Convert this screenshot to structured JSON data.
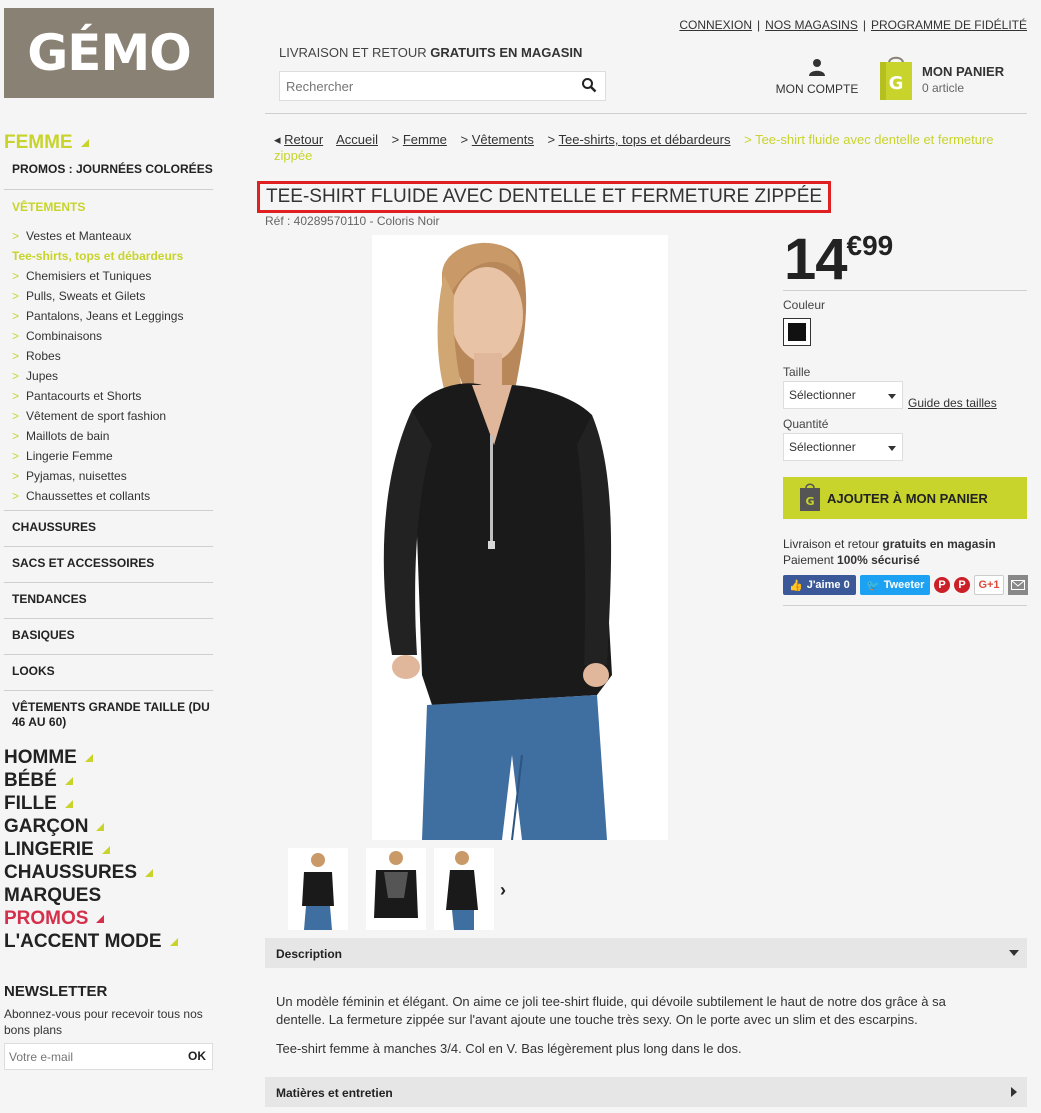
{
  "brand": {
    "logo_text": "GÉMO"
  },
  "header": {
    "top_links": [
      "CONNEXION",
      "NOS MAGASINS",
      "PROGRAMME DE FIDÉLITÉ"
    ],
    "shipping_prefix": "LIVRAISON ET RETOUR",
    "shipping_bold": "GRATUITS EN MAGASIN",
    "search_placeholder": "Rechercher",
    "account_label": "MON COMPTE",
    "cart_title": "MON PANIER",
    "cart_count": "0 article"
  },
  "sidebar": {
    "main_category": "FEMME",
    "promo_section": "PROMOS : JOURNÉES COLORÉES",
    "sub_header": "VÊTEMENTS",
    "sub_items": [
      "Vestes et Manteaux",
      "Tee-shirts, tops et débardeurs",
      "Chemisiers et Tuniques",
      "Pulls, Sweats et Gilets",
      "Pantalons, Jeans et Leggings",
      "Combinaisons",
      "Robes",
      "Jupes",
      "Pantacourts et Shorts",
      "Vêtement de sport fashion",
      "Maillots de bain",
      "Lingerie Femme",
      "Pyjamas, nuisettes",
      "Chaussettes et collants"
    ],
    "active_sub": "Tee-shirts, tops et débardeurs",
    "sections": [
      "CHAUSSURES",
      "SACS ET ACCESSOIRES",
      "TENDANCES",
      "BASIQUES",
      "LOOKS",
      "VÊTEMENTS GRANDE TAILLE (DU 46 AU 60)"
    ],
    "big_categories": [
      "HOMME",
      "BÉBÉ",
      "FILLE",
      "GARÇON",
      "LINGERIE",
      "CHAUSSURES",
      "MARQUES",
      "PROMOS",
      "L'ACCENT MODE"
    ],
    "newsletter_title": "NEWSLETTER",
    "newsletter_text": "Abonnez-vous pour recevoir tous nos bons plans",
    "newsletter_placeholder": "Votre e-mail",
    "newsletter_ok": "OK"
  },
  "breadcrumb": {
    "back": "Retour",
    "items": [
      "Accueil",
      "Femme",
      "Vêtements",
      "Tee-shirts, tops et débardeurs"
    ],
    "current": "Tee-shirt fluide avec dentelle et fermeture zippée"
  },
  "product": {
    "title": "TEE-SHIRT FLUIDE AVEC DENTELLE ET FERMETURE ZIPPÉE",
    "ref": "Réf : 40289570110 - Coloris Noir",
    "price_int": "14",
    "price_dec": "€99",
    "color_label": "Couleur",
    "size_label": "Taille",
    "size_value": "Sélectionner",
    "size_guide": "Guide des tailles",
    "qty_label": "Quantité",
    "qty_value": "Sélectionner",
    "add_to_cart": "AJOUTER À MON PANIER",
    "delivery_prefix": "Livraison et retour",
    "delivery_bold": "gratuits en magasin",
    "payment_prefix": "Paiement",
    "payment_bold": "100% sécurisé",
    "fb_label": "J'aime 0",
    "tw_label": "Tweeter",
    "pin_label": "P",
    "gplus_label": "G+1"
  },
  "accordions": {
    "description_title": "Description",
    "description_p1": "Un modèle féminin et élégant. On aime ce joli tee-shirt fluide, qui dévoile subtilement le haut de notre dos grâce à sa dentelle. La fermeture zippée sur l'avant ajoute une touche très sexy. On le porte avec un slim et des escarpins.",
    "description_p2": "Tee-shirt femme à manches 3/4. Col en V.  Bas légèrement plus long dans le dos.",
    "care_title": "Matières et entretien"
  },
  "colors": {
    "accent": "#c8d42b",
    "promo": "#d4304b",
    "highlight": "#e02020",
    "logo_bg": "#8a8175"
  }
}
